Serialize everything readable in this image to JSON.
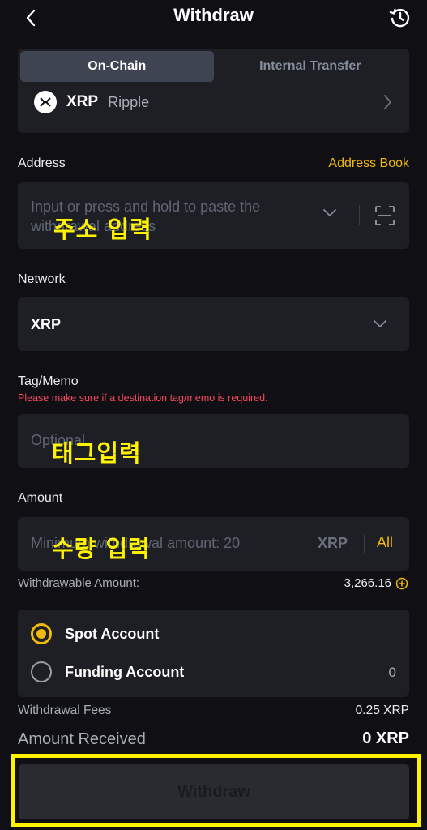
{
  "header": {
    "title": "Withdraw",
    "back_icon": "chevron-left-icon",
    "history_icon": "history-icon"
  },
  "tabs": [
    {
      "label": "On-Chain",
      "active": true
    },
    {
      "label": "Internal Transfer",
      "active": false
    }
  ],
  "coin": {
    "symbol": "XRP",
    "name": "Ripple",
    "icon": "xrp-logo"
  },
  "address": {
    "label": "Address",
    "address_book": "Address Book",
    "placeholder_line1": "Input or press and hold to paste the",
    "placeholder_line2": "withdrawal address",
    "overlay": "주소 입력"
  },
  "network": {
    "label": "Network",
    "value": "XRP"
  },
  "tag": {
    "label": "Tag/Memo",
    "warning": "Please make sure if a destination tag/memo is required.",
    "placeholder": "Optional",
    "overlay": "태그입력"
  },
  "amount": {
    "label": "Amount",
    "placeholder": "Minimum withdrawal amount: 20",
    "unit": "XRP",
    "all": "All",
    "overlay": "수량 입력",
    "withdrawable_label": "Withdrawable Amount:",
    "withdrawable_value": "3,266.16"
  },
  "accounts": [
    {
      "label": "Spot Account",
      "selected": true,
      "value": ""
    },
    {
      "label": "Funding Account",
      "selected": false,
      "value": "0"
    }
  ],
  "fees": {
    "label": "Withdrawal Fees",
    "value": "0.25 XRP"
  },
  "received": {
    "label": "Amount Received",
    "value": "0 XRP"
  },
  "submit": {
    "label": "Withdraw"
  },
  "colors": {
    "accent": "#f0b90b",
    "highlight": "#fff200",
    "warning": "#f6465d",
    "background": "#101014",
    "card": "#1e1f24"
  }
}
